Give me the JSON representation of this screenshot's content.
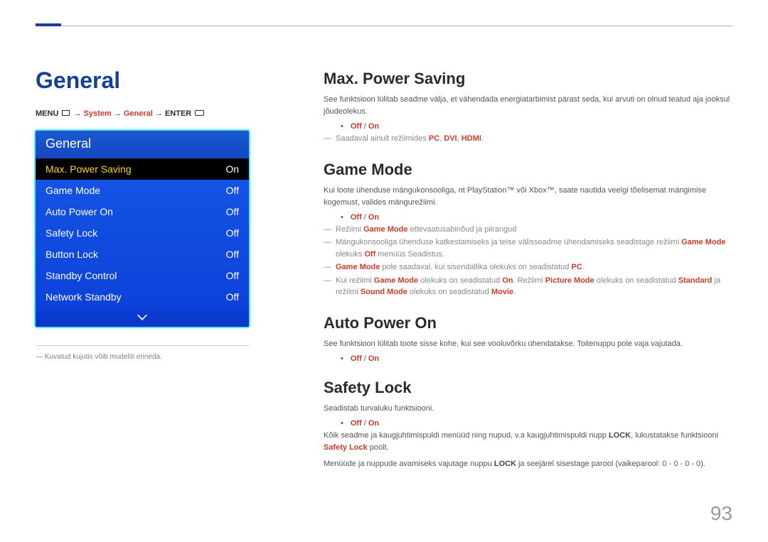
{
  "accent_color": "#163f96",
  "danger_color": "#d13a2a",
  "page_title": "General",
  "breadcrumb": {
    "menu": "MENU",
    "sep": "→",
    "path": [
      "System",
      "General"
    ],
    "enter": "ENTER"
  },
  "tv_panel": {
    "header": "General",
    "selected_index": 0,
    "rows": [
      {
        "label": "Max. Power Saving",
        "value": "On"
      },
      {
        "label": "Game Mode",
        "value": "Off"
      },
      {
        "label": "Auto Power On",
        "value": "Off"
      },
      {
        "label": "Safety Lock",
        "value": "Off"
      },
      {
        "label": "Button Lock",
        "value": "Off"
      },
      {
        "label": "Standby Control",
        "value": "Off"
      },
      {
        "label": "Network Standby",
        "value": "Off"
      }
    ]
  },
  "left_footnote": "Kuvatud kujutis võib mudeliti erineda.",
  "offon": {
    "off": "Off",
    "slash": " / ",
    "on": "On"
  },
  "sections": {
    "max_power_saving": {
      "title": "Max. Power Saving",
      "desc1": "See funktsioon lülitab seadme välja, et vähendada energiatarbimist pärast seda, kui arvuti on olnud teatud aja jooksul jõudeolekus.",
      "note_pre": "Saadaval ainult režiimides ",
      "note_pc": "PC",
      "note_sep1": ", ",
      "note_dvi": "DVI",
      "note_sep2": ", ",
      "note_hdmi": "HDMI",
      "note_post": "."
    },
    "game_mode": {
      "title": "Game Mode",
      "desc1": "Kui loote ühenduse mängukonsooliga, nt PlayStation™ või Xbox™, saate nautida veelgi tõelisemat mängimise kogemust, valides mängurežiimi.",
      "noteA_pre": "Režiimi ",
      "noteA_label": "Game Mode",
      "noteA_post": " ettevaatusabinõud ja piirangud",
      "noteB_pre": "Mängukonsooliga ühenduse katkestamiseks ja teise välisseadme ühendamiseks seadistage režiimi ",
      "noteB_gm": "Game Mode",
      "noteB_mid": " olekuks ",
      "noteB_off": "Off",
      "noteB_post": " menüüs Seadistus.",
      "noteC_gm": "Game Mode",
      "noteC_mid": " pole saadaval, kui sisendallika olekuks on seadistatud ",
      "noteC_pc": "PC",
      "noteC_post": ".",
      "noteD_pre": "Kui režiimi ",
      "noteD_gm": "Game Mode",
      "noteD_mid1": " olekuks on seadistatud ",
      "noteD_on": "On",
      "noteD_mid2": ". Režiimi ",
      "noteD_pm": "Picture Mode",
      "noteD_mid3": " olekuks on seadistatud ",
      "noteD_std": "Standard",
      "noteD_mid4": " ja režiimi ",
      "noteD_sm": "Sound Mode",
      "noteD_mid5": " olekuks on seadistatud ",
      "noteD_movie": "Movie",
      "noteD_post": "."
    },
    "auto_power_on": {
      "title": "Auto Power On",
      "desc1": "See funktsioon lülitab toote sisse kohe, kui see vooluvõrku ühendatakse. Toitenuppu pole vaja vajutada."
    },
    "safety_lock": {
      "title": "Safety Lock",
      "desc1": "Seadistab turvaluku funktsiooni.",
      "desc2_pre": "Kõik seadme ja kaugjuhtimispuldi menüüd ning nupud, v.a kaugjuhtimispuldi nupp ",
      "desc2_lock": "LOCK",
      "desc2_mid": ", lukustatakse funktsiooni ",
      "desc2_sl": "Safety Lock",
      "desc2_post": " poolt.",
      "desc3_pre": "Menüüde ja nuppude avamiseks vajutage nuppu ",
      "desc3_lock": "LOCK",
      "desc3_post": " ja seejärel sisestage parool (vaikeparool: 0 - 0 - 0 - 0)."
    }
  },
  "page_number": "93"
}
